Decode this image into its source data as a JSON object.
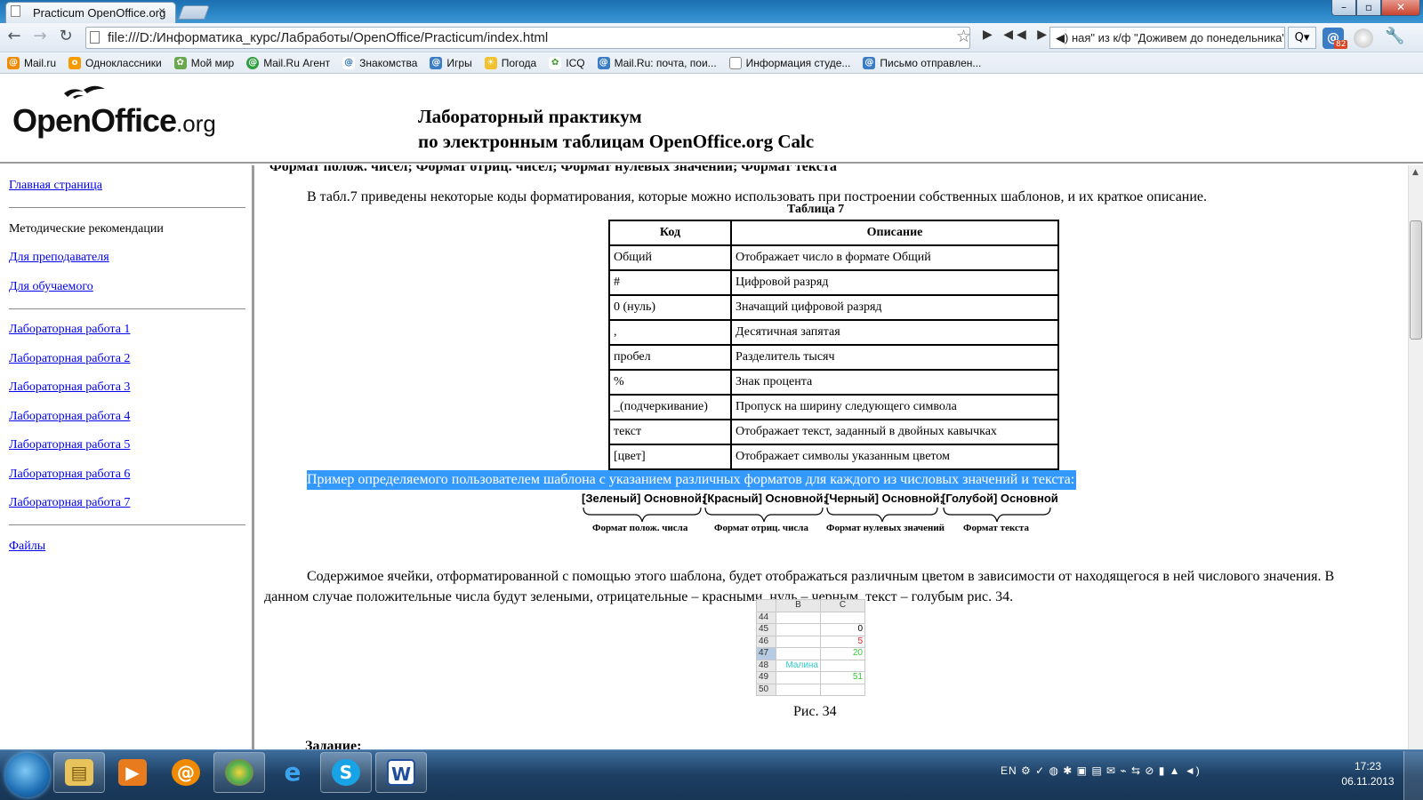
{
  "browser": {
    "tab_title": "Practicum OpenOffice.org",
    "tab_close": "×",
    "window_min": "–",
    "window_max": "▫",
    "window_close": "✕",
    "url": "file:///D:/Информатика_курс/Лабработы/OpenOffice/Practicum/index.html",
    "media_controls": "▶ ◀◀ ▶▶",
    "song": "◀) ная\" из к/ф \"Доживем до понедельника\" (",
    "search_btn": "Q▾",
    "ext_badge": "82",
    "bookmarks": [
      "Mail.ru",
      "Одноклассники",
      "Мой мир",
      "Mail.Ru Агент",
      "Знакомства",
      "Игры",
      "Погода",
      "ICQ",
      "Mail.Ru: почта, пои...",
      "Информация студе...",
      "Письмо отправлен..."
    ],
    "colors": {
      "titlebar": "#2b88c8",
      "link": "#0000ee",
      "highlight": "#3399ff"
    }
  },
  "header": {
    "logo_text": "OpenOffice",
    "logo_suffix": ".org",
    "title_line1": "Лабораторный практикум",
    "title_line2": "по электронным таблицам OpenOffice.org Calc"
  },
  "sidebar": {
    "home": "Главная страница",
    "methods": "Методические рекомендации",
    "for_teacher": "Для преподавателя",
    "for_student": "Для обучаемого",
    "labs": [
      "Лабораторная работа 1",
      "Лабораторная работа 2",
      "Лабораторная работа 3",
      "Лабораторная работа 4",
      "Лабораторная работа 5",
      "Лабораторная работа 6",
      "Лабораторная работа 7"
    ],
    "files": "Файлы"
  },
  "content": {
    "cut_line": "Формат полож. чисел; Формат отриц. чисел; Формат нулевых значений; Формат текста",
    "intro": "В табл.7 приведены некоторые коды форматирования, которые можно использовать при построении собственных шаблонов, и их краткое описание.",
    "table_caption": "Таблица 7",
    "table_headers": [
      "Код",
      "Описание"
    ],
    "table_rows": [
      [
        "Общий",
        "Отображает число в формате Общий"
      ],
      [
        "#",
        "Цифровой разряд"
      ],
      [
        "0 (нуль)",
        "Значащий цифровой разряд"
      ],
      [
        ",",
        "Десятичная запятая"
      ],
      [
        "пробел",
        "Разделитель тысяч"
      ],
      [
        "%",
        "Знак процента"
      ],
      [
        "_(подчеркивание)",
        "Пропуск на ширину следующего символа"
      ],
      [
        "текст",
        "Отображает текст, заданный в двойных кавычках"
      ],
      [
        "[цвет]",
        "Отображает символы указанным цветом"
      ]
    ],
    "highlight": "Пример определяемого пользователем шаблона с указанием различных форматов для каждого из числовых значений и текста:",
    "format_segments": [
      "[Зеленый] Основной;",
      "[Красный] Основной;",
      "[Черный] Основной;",
      "[Голубой] Основной"
    ],
    "format_labels": [
      "Формат полож. числа",
      "Формат отриц. числа",
      "Формат нулевых значений",
      "Формат текста"
    ],
    "para2": "Содержимое ячейки, отформатированной с помощью этого шаблона, будет отображаться различным цветом в зависимости от находящегося в ней числового значения. В данном случае положительные числа будут зелеными, отрицательные – красными, нуль – черным, текст – голубым рис. 34.",
    "sheet": {
      "cols": [
        "B",
        "C"
      ],
      "rows": [
        {
          "n": "44",
          "b": "",
          "c": ""
        },
        {
          "n": "45",
          "b": "",
          "c": "0"
        },
        {
          "n": "46",
          "b": "",
          "c": "5"
        },
        {
          "n": "47",
          "b": "",
          "c": "20"
        },
        {
          "n": "48",
          "b": "Малина",
          "c": ""
        },
        {
          "n": "49",
          "b": "",
          "c": "51"
        },
        {
          "n": "50",
          "b": "",
          "c": ""
        }
      ]
    },
    "figure_caption": "Рис. 34",
    "task": "Задание:"
  },
  "taskbar": {
    "lang": "EN",
    "time": "17:23",
    "date": "06.11.2013"
  }
}
